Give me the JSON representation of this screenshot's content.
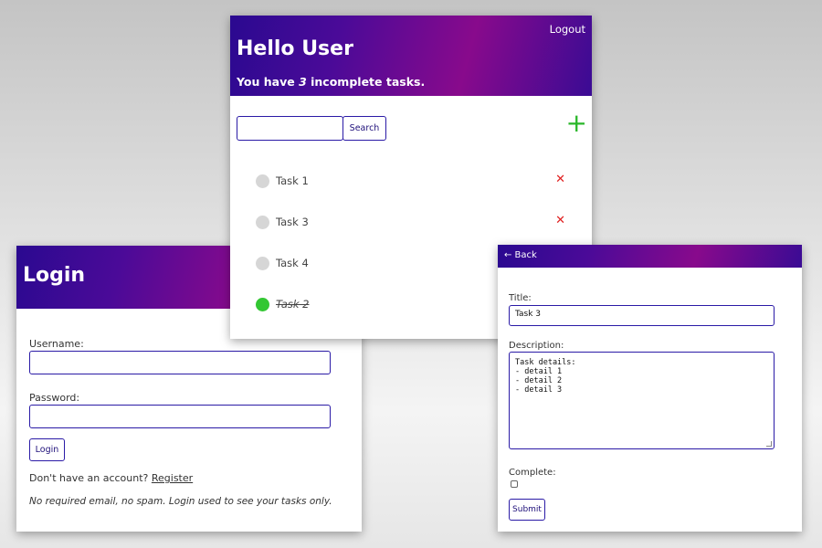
{
  "login": {
    "title": "Login",
    "username_label": "Username:",
    "password_label": "Password:",
    "button": "Login",
    "no_account_text": "Don't have an account?",
    "register_link": "Register",
    "note": "No required email, no spam. Login used to see your tasks only."
  },
  "tasks": {
    "greeting": "Hello User",
    "summary_prefix": "You have",
    "summary_count": "3",
    "summary_suffix": "incomplete tasks.",
    "logout": "Logout",
    "search_button": "Search",
    "search_value": "",
    "add_icon": "plus-icon",
    "delete_icon": "close-icon",
    "items": [
      {
        "name": "Task 1",
        "complete": false
      },
      {
        "name": "Task 3",
        "complete": false
      },
      {
        "name": "Task 4",
        "complete": false
      },
      {
        "name": "Task 2",
        "complete": true
      }
    ]
  },
  "detail": {
    "back_link": "← Back",
    "title_label": "Title:",
    "title_value": "Task 3",
    "description_label": "Description:",
    "description_value": "Task details:\n- detail 1\n- detail 2\n- detail 3",
    "complete_label": "Complete:",
    "complete_checked": false,
    "submit": "Submit"
  },
  "colors": {
    "header_gradient_start": "#2a0990",
    "header_gradient_mid": "#880a8c",
    "border_accent": "#2a1aa6",
    "complete_dot": "#33c733",
    "incomplete_dot": "#d6d6d6",
    "delete_x": "#e02020",
    "add_plus": "#2ab72a"
  }
}
